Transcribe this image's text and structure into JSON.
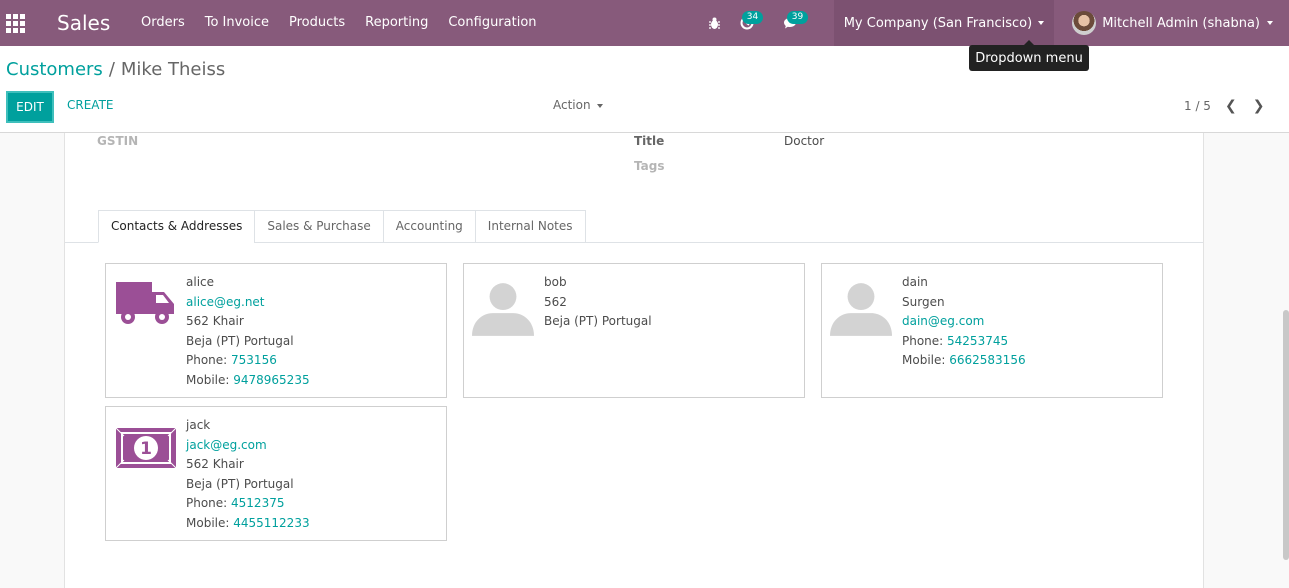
{
  "navbar": {
    "brand": "Sales",
    "menu": [
      "Orders",
      "To Invoice",
      "Products",
      "Reporting",
      "Configuration"
    ],
    "activity_count": "34",
    "messages_count": "39",
    "company": "My Company (San Francisco)",
    "user": "Mitchell Admin (shabna)"
  },
  "tooltip": "Dropdown menu",
  "breadcrumb": {
    "parent": "Customers",
    "separator": "/",
    "current": "Mike Theiss"
  },
  "buttons": {
    "edit": "EDIT",
    "create": "CREATE",
    "action": "Action"
  },
  "pager": {
    "value": "1 / 5"
  },
  "fields": {
    "gstin_label": "GSTIN",
    "title_label": "Title",
    "title_value": "Doctor",
    "tags_label": "Tags"
  },
  "tabs": [
    "Contacts & Addresses",
    "Sales & Purchase",
    "Accounting",
    "Internal Notes"
  ],
  "contacts": [
    {
      "name": "alice",
      "email": "alice@eg.net",
      "street": "562 Khair",
      "city": "Beja (PT) Portugal",
      "phone_label": "Phone: ",
      "phone": "753156",
      "mobile_label": "Mobile: ",
      "mobile": "9478965235",
      "icon": "truck-icon"
    },
    {
      "name": "bob",
      "street": "562",
      "city": "Beja (PT) Portugal",
      "icon": "person-placeholder-icon"
    },
    {
      "name": "dain",
      "job": "Surgen",
      "email": "dain@eg.com",
      "phone_label": "Phone: ",
      "phone": "54253745",
      "mobile_label": "Mobile: ",
      "mobile": "6662583156",
      "icon": "person-placeholder-icon"
    },
    {
      "name": "jack",
      "email": "jack@eg.com",
      "street": "562 Khair",
      "city": "Beja (PT) Portugal",
      "phone_label": "Phone: ",
      "phone": "4512375",
      "mobile_label": "Mobile: ",
      "mobile": "4455112233",
      "icon": "money-icon"
    }
  ],
  "colors": {
    "navbar": "#875a7b",
    "accent": "#00a09d",
    "card_icon": "#9b4f96"
  }
}
